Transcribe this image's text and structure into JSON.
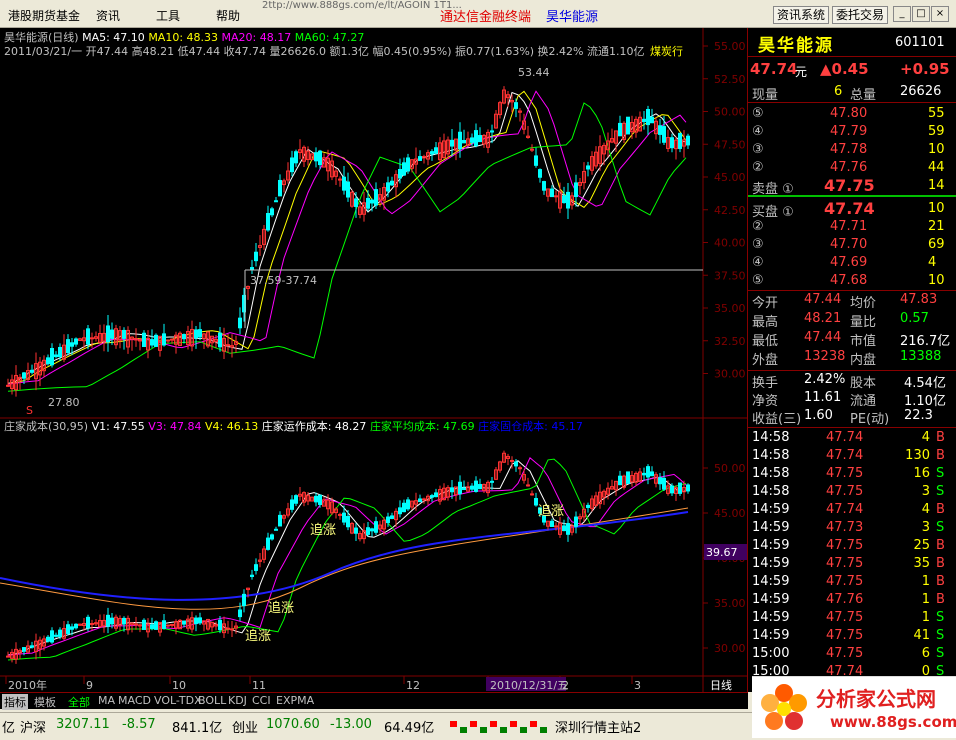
{
  "menu": {
    "items": [
      "港股期货基金",
      "资讯",
      "工具",
      "帮助"
    ],
    "address": "2ttp://www.888gs.com/e/lt/AGOIN 1T1...",
    "brand_title": "通达信金融终端",
    "stock_title": "昊华能源",
    "news_button": "资讯系统",
    "trade_button": "委托交易"
  },
  "chart": {
    "info_line1": [
      {
        "t": "昊华能源(日线)",
        "c": "#c0c0c0"
      },
      {
        "t": "MA5: 47.10",
        "c": "#ffffff"
      },
      {
        "t": "MA10: 48.33",
        "c": "#ffff00"
      },
      {
        "t": "MA20: 48.17",
        "c": "#ff00ff"
      },
      {
        "t": "MA60: 47.27",
        "c": "#00ff00"
      }
    ],
    "info_line2": "2011/03/21/一 开47.44 高48.21 低47.44 收47.74 量26626.0 额1.3亿 幅0.45(0.95%) 振0.77(1.63%) 换2.42% 流通1.10亿",
    "industry": "煤炭行",
    "price_labels": [
      "55.00",
      "52.50",
      "50.00",
      "47.50",
      "45.00",
      "42.50",
      "40.00",
      "37.50",
      "35.00",
      "32.50",
      "30.00"
    ],
    "high_label": "53.44",
    "low_label": "27.80",
    "range_label": "37.59-37.74",
    "bottom_info": [
      {
        "t": "庄家成本(30,95)",
        "c": "#c0c0c0"
      },
      {
        "t": "V1: 47.55",
        "c": "#ffffff"
      },
      {
        "t": "V3: 47.84",
        "c": "#ff00ff"
      },
      {
        "t": "V4: 46.13",
        "c": "#ffff00"
      },
      {
        "t": "庄家运作成本: 48.27",
        "c": "#ffffff"
      },
      {
        "t": "庄家平均成本: 47.69",
        "c": "#00ff00"
      },
      {
        "t": "庄家固仓成本: 45.17",
        "c": "#0000ff"
      }
    ],
    "bottom_price_labels": [
      "50.00",
      "45.00",
      "40.00",
      "35.00",
      "30.00"
    ],
    "current_label": "39.67",
    "chase_label": "追涨",
    "x_labels": [
      "2010年",
      "9",
      "10",
      "11",
      "12",
      "2010/12/31/五",
      "2",
      "3"
    ],
    "period_label": "日线"
  },
  "right": {
    "name": "昊华能源",
    "code": "601101",
    "price": "47.74",
    "yuan": "元",
    "change": "▲0.45",
    "pct": "+0.95",
    "now_vol_label": "现量",
    "now_vol": "6",
    "total_vol_label": "总量",
    "total_vol": "26626",
    "asks": [
      {
        "lbl": "⑤",
        "p": "47.80",
        "v": "55"
      },
      {
        "lbl": "④",
        "p": "47.79",
        "v": "59"
      },
      {
        "lbl": "③",
        "p": "47.78",
        "v": "10"
      },
      {
        "lbl": "②",
        "p": "47.76",
        "v": "44"
      },
      {
        "lbl": "卖盘 ①",
        "p": "47.75",
        "v": "14"
      }
    ],
    "bids": [
      {
        "lbl": "买盘 ①",
        "p": "47.74",
        "v": "10"
      },
      {
        "lbl": "②",
        "p": "47.71",
        "v": "21"
      },
      {
        "lbl": "③",
        "p": "47.70",
        "v": "69"
      },
      {
        "lbl": "④",
        "p": "47.69",
        "v": "4"
      },
      {
        "lbl": "⑤",
        "p": "47.68",
        "v": "10"
      }
    ],
    "stats": [
      {
        "a": "今开",
        "av": "47.44",
        "ac": "#ff4040",
        "b": "均价",
        "bv": "47.83",
        "bc": "#ff4040"
      },
      {
        "a": "最高",
        "av": "48.21",
        "ac": "#ff4040",
        "b": "量比",
        "bv": "0.57",
        "bc": "#00ff00"
      },
      {
        "a": "最低",
        "av": "47.44",
        "ac": "#ff4040",
        "b": "市值",
        "bv": "216.7亿",
        "bc": "#ffffff"
      },
      {
        "a": "外盘",
        "av": "13238",
        "ac": "#ff4040",
        "b": "内盘",
        "bv": "13388",
        "bc": "#00ff00"
      }
    ],
    "stats2": [
      {
        "a": "换手",
        "av": "2.42%",
        "b": "股本",
        "bv": "4.54亿"
      },
      {
        "a": "净资",
        "av": "11.61",
        "b": "流通",
        "bv": "1.10亿"
      },
      {
        "a": "收益(三)",
        "av": "1.60",
        "b": "PE(动)",
        "bv": "22.3"
      }
    ],
    "ticks": [
      {
        "t": "14:58",
        "p": "47.74",
        "v": "4",
        "d": "B"
      },
      {
        "t": "14:58",
        "p": "47.74",
        "v": "130",
        "d": "B"
      },
      {
        "t": "14:58",
        "p": "47.75",
        "v": "16",
        "d": "S"
      },
      {
        "t": "14:58",
        "p": "47.75",
        "v": "3",
        "d": "S"
      },
      {
        "t": "14:59",
        "p": "47.74",
        "v": "4",
        "d": "B"
      },
      {
        "t": "14:59",
        "p": "47.73",
        "v": "3",
        "d": "S"
      },
      {
        "t": "14:59",
        "p": "47.75",
        "v": "25",
        "d": "B"
      },
      {
        "t": "14:59",
        "p": "47.75",
        "v": "35",
        "d": "B"
      },
      {
        "t": "14:59",
        "p": "47.75",
        "v": "1",
        "d": "B"
      },
      {
        "t": "14:59",
        "p": "47.76",
        "v": "1",
        "d": "B"
      },
      {
        "t": "14:59",
        "p": "47.75",
        "v": "1",
        "d": "S"
      },
      {
        "t": "14:59",
        "p": "47.75",
        "v": "41",
        "d": "S"
      },
      {
        "t": "15:00",
        "p": "47.75",
        "v": "6",
        "d": "S"
      },
      {
        "t": "15:00",
        "p": "47.74",
        "v": "0",
        "d": "S"
      }
    ]
  },
  "tabs": [
    "指标",
    "模板",
    "全部",
    "MA",
    "MACD",
    "VOL-TDX",
    "BOLL",
    "KDJ",
    "CCI",
    "EXPMA"
  ],
  "status": {
    "left_cut": "亿",
    "sh_label": "沪深",
    "sh_val": "3207.11",
    "sh_chg": "-8.57",
    "sh_amt": "841.1亿",
    "cy_label": "创业",
    "cy_val": "1070.60",
    "cy_chg": "-13.00",
    "cy_amt": "64.49亿",
    "server": "深圳行情主站2"
  },
  "watermark": {
    "title": "分析家公式网",
    "url": "www.88gs.com"
  }
}
